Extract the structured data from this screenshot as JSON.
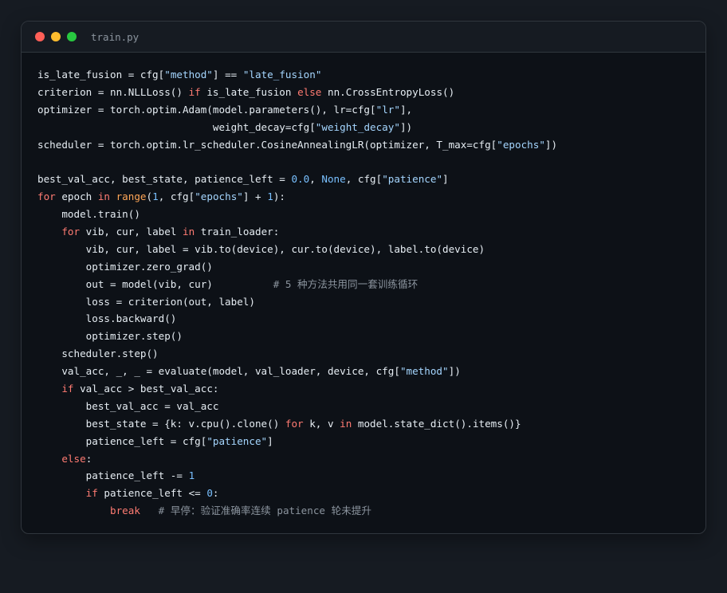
{
  "window": {
    "filename": "train.py",
    "traffic_lights": [
      "close",
      "minimize",
      "zoom"
    ]
  },
  "colors": {
    "keyword": "#ff7b72",
    "string": "#a5d6ff",
    "number": "#79c0ff",
    "builtin": "#ffa657",
    "comment": "#8b949e",
    "text": "#e6edf3",
    "editor_bg": "#0d1117",
    "page_bg": "#161b22"
  },
  "code_lines": [
    [
      [
        "tx",
        "is_late_fusion = cfg["
      ],
      [
        "str",
        "\"method\""
      ],
      [
        "tx",
        "] == "
      ],
      [
        "str",
        "\"late_fusion\""
      ]
    ],
    [
      [
        "tx",
        "criterion = nn.NLLLoss() "
      ],
      [
        "kw",
        "if"
      ],
      [
        "tx",
        " is_late_fusion "
      ],
      [
        "kw",
        "else"
      ],
      [
        "tx",
        " nn.CrossEntropyLoss()"
      ]
    ],
    [
      [
        "tx",
        "optimizer = torch.optim.Adam(model.parameters(), lr=cfg["
      ],
      [
        "str",
        "\"lr\""
      ],
      [
        "tx",
        "],"
      ]
    ],
    [
      [
        "tx",
        "                             weight_decay=cfg["
      ],
      [
        "str",
        "\"weight_decay\""
      ],
      [
        "tx",
        "])"
      ]
    ],
    [
      [
        "tx",
        "scheduler = torch.optim.lr_scheduler.CosineAnnealingLR(optimizer, T_max=cfg["
      ],
      [
        "str",
        "\"epochs\""
      ],
      [
        "tx",
        "])"
      ]
    ],
    [],
    [
      [
        "tx",
        "best_val_acc, best_state, patience_left = "
      ],
      [
        "num",
        "0.0"
      ],
      [
        "tx",
        ", "
      ],
      [
        "num",
        "None"
      ],
      [
        "tx",
        ", cfg["
      ],
      [
        "str",
        "\"patience\""
      ],
      [
        "tx",
        "]"
      ]
    ],
    [
      [
        "kw",
        "for"
      ],
      [
        "tx",
        " epoch "
      ],
      [
        "kw",
        "in"
      ],
      [
        "tx",
        " "
      ],
      [
        "bi",
        "range"
      ],
      [
        "tx",
        "("
      ],
      [
        "num",
        "1"
      ],
      [
        "tx",
        ", cfg["
      ],
      [
        "str",
        "\"epochs\""
      ],
      [
        "tx",
        "] + "
      ],
      [
        "num",
        "1"
      ],
      [
        "tx",
        "):"
      ]
    ],
    [
      [
        "tx",
        "    model.train()"
      ]
    ],
    [
      [
        "tx",
        "    "
      ],
      [
        "kw",
        "for"
      ],
      [
        "tx",
        " vib, cur, label "
      ],
      [
        "kw",
        "in"
      ],
      [
        "tx",
        " train_loader:"
      ]
    ],
    [
      [
        "tx",
        "        vib, cur, label = vib.to(device), cur.to(device), label.to(device)"
      ]
    ],
    [
      [
        "tx",
        "        optimizer.zero_grad()"
      ]
    ],
    [
      [
        "tx",
        "        out = model(vib, cur)          "
      ],
      [
        "cm",
        "# 5 种方法共用同一套训练循环"
      ]
    ],
    [
      [
        "tx",
        "        loss = criterion(out, label)"
      ]
    ],
    [
      [
        "tx",
        "        loss.backward()"
      ]
    ],
    [
      [
        "tx",
        "        optimizer.step()"
      ]
    ],
    [
      [
        "tx",
        "    scheduler.step()"
      ]
    ],
    [
      [
        "tx",
        "    val_acc, _, _ = evaluate(model, val_loader, device, cfg["
      ],
      [
        "str",
        "\"method\""
      ],
      [
        "tx",
        "])"
      ]
    ],
    [
      [
        "tx",
        "    "
      ],
      [
        "kw",
        "if"
      ],
      [
        "tx",
        " val_acc > best_val_acc:"
      ]
    ],
    [
      [
        "tx",
        "        best_val_acc = val_acc"
      ]
    ],
    [
      [
        "tx",
        "        best_state = {k: v.cpu().clone() "
      ],
      [
        "kw",
        "for"
      ],
      [
        "tx",
        " k, v "
      ],
      [
        "kw",
        "in"
      ],
      [
        "tx",
        " model.state_dict().items()}"
      ]
    ],
    [
      [
        "tx",
        "        patience_left = cfg["
      ],
      [
        "str",
        "\"patience\""
      ],
      [
        "tx",
        "]"
      ]
    ],
    [
      [
        "tx",
        "    "
      ],
      [
        "kw",
        "else"
      ],
      [
        "tx",
        ":"
      ]
    ],
    [
      [
        "tx",
        "        patience_left -= "
      ],
      [
        "num",
        "1"
      ]
    ],
    [
      [
        "tx",
        "        "
      ],
      [
        "kw",
        "if"
      ],
      [
        "tx",
        " patience_left <= "
      ],
      [
        "num",
        "0"
      ],
      [
        "tx",
        ":"
      ]
    ],
    [
      [
        "tx",
        "            "
      ],
      [
        "kw",
        "break"
      ],
      [
        "tx",
        "   "
      ],
      [
        "cm",
        "# 早停：验证准确率连续 patience 轮未提升"
      ]
    ]
  ]
}
